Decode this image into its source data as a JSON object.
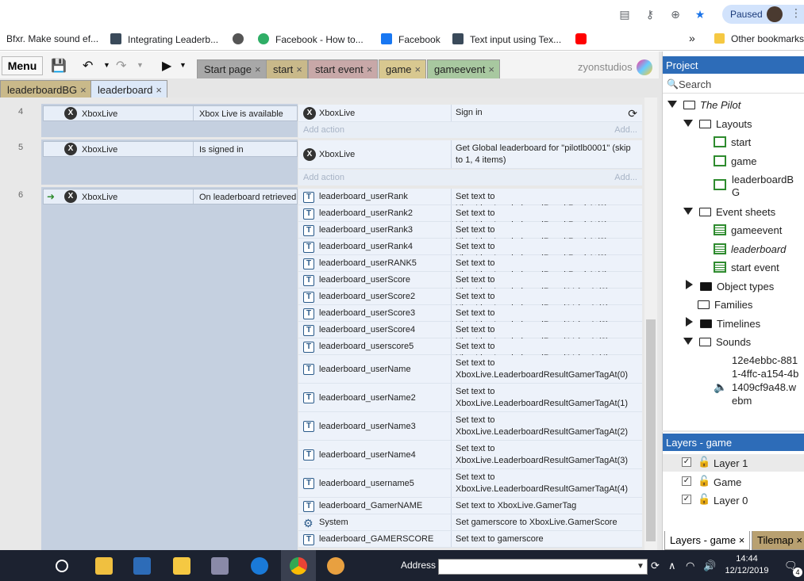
{
  "browser": {
    "paused_label": "Paused",
    "bookmarks": [
      {
        "label": "Bfxr. Make sound ef...",
        "color": "#ffffff"
      },
      {
        "label": "Integrating Leaderb...",
        "color": "#3a4a5a"
      },
      {
        "label": "",
        "color": "#555555"
      },
      {
        "label": "Facebook - How to...",
        "color": "#2fae66"
      },
      {
        "label": "Facebook",
        "color": "#1877f2"
      },
      {
        "label": "Text input using Tex...",
        "color": "#3a4a5a"
      },
      {
        "label": "",
        "color": "#ff0000"
      }
    ],
    "more_label": "»",
    "other_bookmarks": "Other bookmarks"
  },
  "toolbar": {
    "menu_label": "Menu",
    "tabs_row1": [
      {
        "label": "Start page",
        "color": "#a8a8a8"
      },
      {
        "label": "start",
        "color": "#c9b98a"
      },
      {
        "label": "start event",
        "color": "#c8a8a8"
      },
      {
        "label": "game",
        "color": "#d8c890"
      },
      {
        "label": "gameevent",
        "color": "#a8c8a0"
      }
    ],
    "tabs_row2": [
      {
        "label": "leaderboardBG",
        "color": "#c9b98a"
      },
      {
        "label": "leaderboard",
        "color": "#dce8f8"
      }
    ],
    "brand": "zyonstudios",
    "close_glyph": "×"
  },
  "events": [
    {
      "number": "4",
      "object": "XboxLive",
      "condition": "Xbox Live is available",
      "actions": [
        {
          "object": "XboxLive",
          "text": "Sign in"
        }
      ],
      "add_action": "Add action",
      "add_short": "Add..."
    },
    {
      "number": "5",
      "object": "XboxLive",
      "condition": "Is signed in",
      "actions": [
        {
          "object": "XboxLive",
          "text": "Get Global leaderboard for \"pilotlb0001\" (skip to 1, 4 items)"
        }
      ],
      "add_action": "Add action",
      "add_short": "Add..."
    },
    {
      "number": "6",
      "object": "XboxLive",
      "condition": "On leaderboard retrieved",
      "actions": [
        {
          "object": "leaderboard_userRank",
          "text": "Set text to XboxLive.LeaderboardResultRankAt(0)"
        },
        {
          "object": "leaderboard_userRank2",
          "text": "Set text to XboxLive.LeaderboardResultRankAt(1)"
        },
        {
          "object": "leaderboard_userRank3",
          "text": "Set text to XboxLive.LeaderboardResultRankAt(2)"
        },
        {
          "object": "leaderboard_userRank4",
          "text": "Set text to XboxLive.LeaderboardResultRankAt(3)"
        },
        {
          "object": "leaderboard_userRANK5",
          "text": "Set text to XboxLive.LeaderboardResultRankAt(4)"
        },
        {
          "object": "leaderboard_userScore",
          "text": "Set text to XboxLive.LeaderboardResultValueAt(0)"
        },
        {
          "object": "leaderboard_userScore2",
          "text": "Set text to XboxLive.LeaderboardResultValueAt(1)"
        },
        {
          "object": "leaderboard_userScore3",
          "text": "Set text to XboxLive.LeaderboardResultValueAt(2)"
        },
        {
          "object": "leaderboard_userScore4",
          "text": "Set text to XboxLive.LeaderboardResultValueAt(3)"
        },
        {
          "object": "leaderboard_userscore5",
          "text": "Set text to XboxLive.LeaderboardResultValueAt(4)"
        },
        {
          "object": "leaderboard_userName",
          "text": "Set text to XboxLive.LeaderboardResultGamerTagAt(0)"
        },
        {
          "object": "leaderboard_userName2",
          "text": "Set text to XboxLive.LeaderboardResultGamerTagAt(1)"
        },
        {
          "object": "leaderboard_userName3",
          "text": "Set text to XboxLive.LeaderboardResultGamerTagAt(2)"
        },
        {
          "object": "leaderboard_userName4",
          "text": "Set text to XboxLive.LeaderboardResultGamerTagAt(3)"
        },
        {
          "object": "leaderboard_username5",
          "text": "Set text to XboxLive.LeaderboardResultGamerTagAt(4)"
        },
        {
          "object": "leaderboard_GamerNAME",
          "text": "Set text to XboxLive.GamerTag"
        },
        {
          "object": "System",
          "text": "Set gamerscore to XboxLive.GamerScore"
        },
        {
          "object": "leaderboard_GAMERSCORE",
          "text": "Set text to gamerscore"
        }
      ]
    }
  ],
  "project": {
    "header": "Project",
    "search_placeholder": "Search",
    "root": "The Pilot",
    "layouts_label": "Layouts",
    "layouts": [
      "start",
      "game",
      "leaderboardBG"
    ],
    "event_sheets_label": "Event sheets",
    "event_sheets": [
      "gameevent",
      "leaderboard",
      "start event"
    ],
    "object_types": "Object types",
    "families": "Families",
    "timelines": "Timelines",
    "sounds": "Sounds",
    "sound_file": "12e4ebbc-8811-4ffc-a154-4b1409cf9a48.webm"
  },
  "layers": {
    "header": "Layers - game",
    "items": [
      "Layer 1",
      "Game",
      "Layer 0"
    ],
    "tab_active": "Layers - game",
    "tab_other": "Tilemap"
  },
  "taskbar": {
    "address_label": "Address",
    "time": "14:44",
    "date": "12/12/2019",
    "notif_count": "4"
  }
}
